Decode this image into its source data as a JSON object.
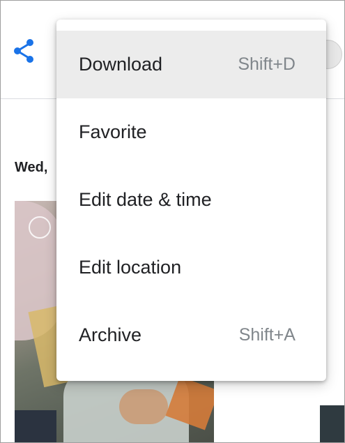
{
  "toolbar": {
    "share_icon": "share-icon",
    "accent_color": "#1a73e8"
  },
  "content": {
    "date_heading": "Wed,"
  },
  "menu": {
    "items": [
      {
        "label": "Download",
        "shortcut": "Shift+D",
        "highlighted": true
      },
      {
        "label": "Favorite",
        "shortcut": ""
      },
      {
        "label": "Edit date & time",
        "shortcut": ""
      },
      {
        "label": "Edit location",
        "shortcut": ""
      },
      {
        "label": "Archive",
        "shortcut": "Shift+A"
      }
    ]
  }
}
